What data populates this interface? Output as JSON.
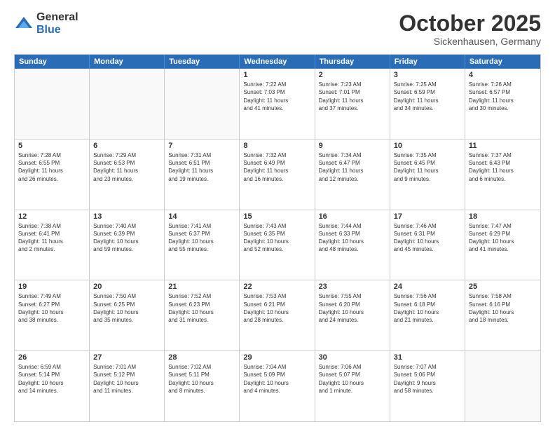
{
  "logo": {
    "general": "General",
    "blue": "Blue"
  },
  "header": {
    "month": "October 2025",
    "location": "Sickenhausen, Germany"
  },
  "weekdays": [
    "Sunday",
    "Monday",
    "Tuesday",
    "Wednesday",
    "Thursday",
    "Friday",
    "Saturday"
  ],
  "rows": [
    [
      {
        "day": "",
        "info": ""
      },
      {
        "day": "",
        "info": ""
      },
      {
        "day": "",
        "info": ""
      },
      {
        "day": "1",
        "info": "Sunrise: 7:22 AM\nSunset: 7:03 PM\nDaylight: 11 hours\nand 41 minutes."
      },
      {
        "day": "2",
        "info": "Sunrise: 7:23 AM\nSunset: 7:01 PM\nDaylight: 11 hours\nand 37 minutes."
      },
      {
        "day": "3",
        "info": "Sunrise: 7:25 AM\nSunset: 6:59 PM\nDaylight: 11 hours\nand 34 minutes."
      },
      {
        "day": "4",
        "info": "Sunrise: 7:26 AM\nSunset: 6:57 PM\nDaylight: 11 hours\nand 30 minutes."
      }
    ],
    [
      {
        "day": "5",
        "info": "Sunrise: 7:28 AM\nSunset: 6:55 PM\nDaylight: 11 hours\nand 26 minutes."
      },
      {
        "day": "6",
        "info": "Sunrise: 7:29 AM\nSunset: 6:53 PM\nDaylight: 11 hours\nand 23 minutes."
      },
      {
        "day": "7",
        "info": "Sunrise: 7:31 AM\nSunset: 6:51 PM\nDaylight: 11 hours\nand 19 minutes."
      },
      {
        "day": "8",
        "info": "Sunrise: 7:32 AM\nSunset: 6:49 PM\nDaylight: 11 hours\nand 16 minutes."
      },
      {
        "day": "9",
        "info": "Sunrise: 7:34 AM\nSunset: 6:47 PM\nDaylight: 11 hours\nand 12 minutes."
      },
      {
        "day": "10",
        "info": "Sunrise: 7:35 AM\nSunset: 6:45 PM\nDaylight: 11 hours\nand 9 minutes."
      },
      {
        "day": "11",
        "info": "Sunrise: 7:37 AM\nSunset: 6:43 PM\nDaylight: 11 hours\nand 6 minutes."
      }
    ],
    [
      {
        "day": "12",
        "info": "Sunrise: 7:38 AM\nSunset: 6:41 PM\nDaylight: 11 hours\nand 2 minutes."
      },
      {
        "day": "13",
        "info": "Sunrise: 7:40 AM\nSunset: 6:39 PM\nDaylight: 10 hours\nand 59 minutes."
      },
      {
        "day": "14",
        "info": "Sunrise: 7:41 AM\nSunset: 6:37 PM\nDaylight: 10 hours\nand 55 minutes."
      },
      {
        "day": "15",
        "info": "Sunrise: 7:43 AM\nSunset: 6:35 PM\nDaylight: 10 hours\nand 52 minutes."
      },
      {
        "day": "16",
        "info": "Sunrise: 7:44 AM\nSunset: 6:33 PM\nDaylight: 10 hours\nand 48 minutes."
      },
      {
        "day": "17",
        "info": "Sunrise: 7:46 AM\nSunset: 6:31 PM\nDaylight: 10 hours\nand 45 minutes."
      },
      {
        "day": "18",
        "info": "Sunrise: 7:47 AM\nSunset: 6:29 PM\nDaylight: 10 hours\nand 41 minutes."
      }
    ],
    [
      {
        "day": "19",
        "info": "Sunrise: 7:49 AM\nSunset: 6:27 PM\nDaylight: 10 hours\nand 38 minutes."
      },
      {
        "day": "20",
        "info": "Sunrise: 7:50 AM\nSunset: 6:25 PM\nDaylight: 10 hours\nand 35 minutes."
      },
      {
        "day": "21",
        "info": "Sunrise: 7:52 AM\nSunset: 6:23 PM\nDaylight: 10 hours\nand 31 minutes."
      },
      {
        "day": "22",
        "info": "Sunrise: 7:53 AM\nSunset: 6:21 PM\nDaylight: 10 hours\nand 28 minutes."
      },
      {
        "day": "23",
        "info": "Sunrise: 7:55 AM\nSunset: 6:20 PM\nDaylight: 10 hours\nand 24 minutes."
      },
      {
        "day": "24",
        "info": "Sunrise: 7:56 AM\nSunset: 6:18 PM\nDaylight: 10 hours\nand 21 minutes."
      },
      {
        "day": "25",
        "info": "Sunrise: 7:58 AM\nSunset: 6:16 PM\nDaylight: 10 hours\nand 18 minutes."
      }
    ],
    [
      {
        "day": "26",
        "info": "Sunrise: 6:59 AM\nSunset: 5:14 PM\nDaylight: 10 hours\nand 14 minutes."
      },
      {
        "day": "27",
        "info": "Sunrise: 7:01 AM\nSunset: 5:12 PM\nDaylight: 10 hours\nand 11 minutes."
      },
      {
        "day": "28",
        "info": "Sunrise: 7:02 AM\nSunset: 5:11 PM\nDaylight: 10 hours\nand 8 minutes."
      },
      {
        "day": "29",
        "info": "Sunrise: 7:04 AM\nSunset: 5:09 PM\nDaylight: 10 hours\nand 4 minutes."
      },
      {
        "day": "30",
        "info": "Sunrise: 7:06 AM\nSunset: 5:07 PM\nDaylight: 10 hours\nand 1 minute."
      },
      {
        "day": "31",
        "info": "Sunrise: 7:07 AM\nSunset: 5:06 PM\nDaylight: 9 hours\nand 58 minutes."
      },
      {
        "day": "",
        "info": ""
      }
    ]
  ]
}
